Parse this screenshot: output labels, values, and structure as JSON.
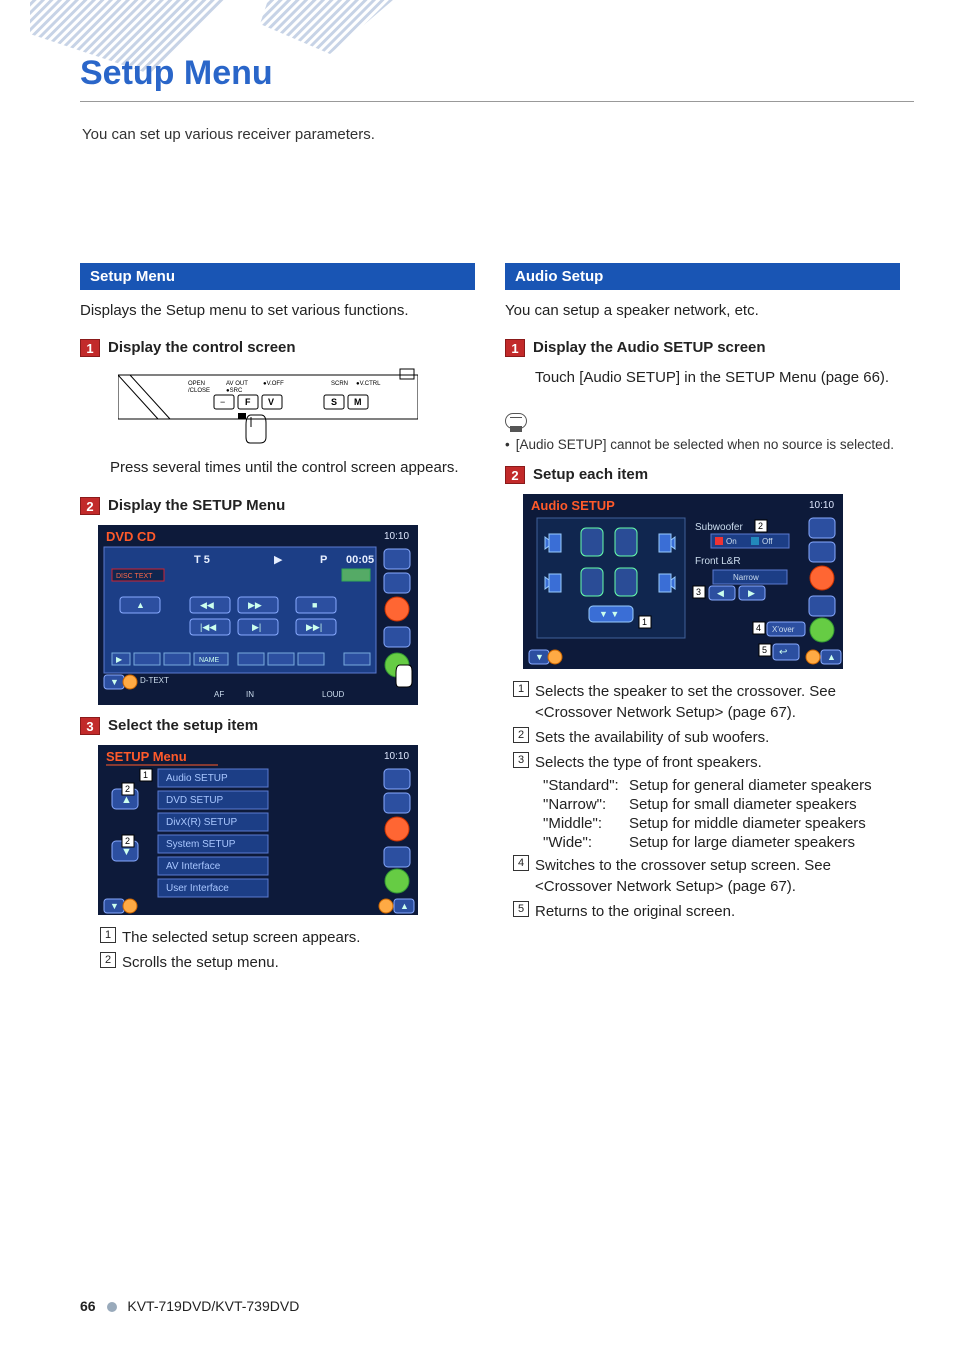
{
  "page_title": "Setup Menu",
  "intro": "You can set up various receiver parameters.",
  "footer": {
    "page_number": "66",
    "model": "KVT-719DVD/KVT-739DVD"
  },
  "left": {
    "section_title": "Setup Menu",
    "section_desc": "Displays the Setup menu to set various functions.",
    "step1": {
      "num": "1",
      "title": "Display the control screen",
      "after": "Press several times until the control screen appears.",
      "diagram": {
        "labels": [
          "OPEN /CLOSE",
          "AV OUT",
          "SRC",
          "V.OFF",
          "SCRN",
          "V.CTRL"
        ],
        "buttons_row1": [
          "−",
          "F",
          "V"
        ],
        "buttons_row2": [
          "S",
          "M"
        ]
      }
    },
    "step2": {
      "num": "2",
      "title": "Display the SETUP Menu",
      "shot": {
        "header": "DVD CD",
        "clock": "10:10",
        "track_label": "T  5",
        "p_label": "P",
        "time": "00:05",
        "disc_text": "DISC TEXT",
        "bottom_label": "D-TEXT",
        "name_btn": "NAME",
        "footer_labels": [
          "AF",
          "IN",
          "LOUD"
        ]
      }
    },
    "step3": {
      "num": "3",
      "title": "Select the setup item",
      "shot": {
        "header": "SETUP Menu",
        "clock": "10:10",
        "items": [
          "Audio SETUP",
          "DVD SETUP",
          "DivX(R) SETUP",
          "System SETUP",
          "AV Interface",
          "User Interface"
        ]
      }
    },
    "refs": [
      {
        "n": "1",
        "t": "The selected setup screen appears."
      },
      {
        "n": "2",
        "t": "Scrolls the setup menu."
      }
    ]
  },
  "right": {
    "section_title": "Audio Setup",
    "section_desc": "You can setup a speaker network, etc.",
    "step1": {
      "num": "1",
      "title": "Display the Audio SETUP screen",
      "body": "Touch [Audio SETUP] in the SETUP Menu (page 66).",
      "note": "[Audio SETUP] cannot be selected when no source is selected."
    },
    "step2": {
      "num": "2",
      "title": "Setup each item",
      "shot": {
        "header": "Audio SETUP",
        "clock": "10:10",
        "subwoofer_label": "Subwoofer",
        "subwoofer_on": "On",
        "subwoofer_off": "Off",
        "front_label": "Front L&R",
        "front_value": "Narrow",
        "xover_btn": "X'over"
      }
    },
    "refs": [
      {
        "n": "1",
        "t": "Selects the speaker to set the crossover. See <Crossover Network Setup> (page 67)."
      },
      {
        "n": "2",
        "t": "Sets the availability of sub woofers."
      },
      {
        "n": "3",
        "t": "Selects the type of front speakers."
      }
    ],
    "speaker_types": [
      {
        "k": "\"Standard\":",
        "v": "Setup for general diameter speakers"
      },
      {
        "k": "\"Narrow\":",
        "v": "Setup for small diameter speakers"
      },
      {
        "k": "\"Middle\":",
        "v": "Setup for middle diameter speakers"
      },
      {
        "k": "\"Wide\":",
        "v": "Setup for large diameter speakers"
      }
    ],
    "refs2": [
      {
        "n": "4",
        "t": "Switches to the crossover setup screen. See <Crossover Network Setup> (page 67)."
      },
      {
        "n": "5",
        "t": "Returns to the original screen."
      }
    ]
  }
}
